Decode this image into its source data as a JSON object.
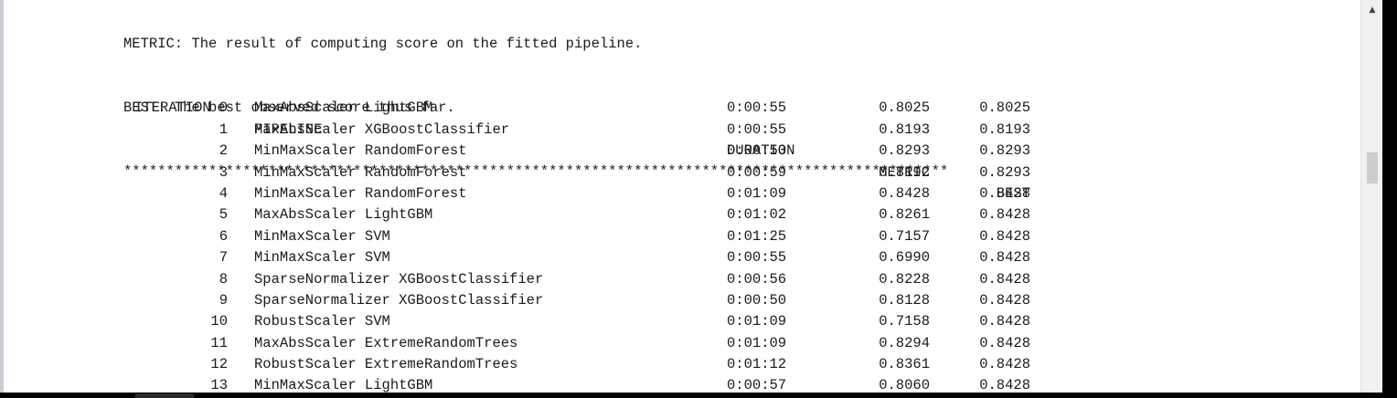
{
  "header": {
    "metric_line": "METRIC: The result of computing score on the fitted pipeline.",
    "best_line": "BEST: The best observed score thus far.",
    "separator": "*************************************************************************************************"
  },
  "table": {
    "columns": {
      "iteration": "ITERATION",
      "pipeline": "PIPELINE",
      "duration": "DURATION",
      "metric": "METRIC",
      "best": "BEST"
    },
    "rows": [
      {
        "iteration": "0",
        "pipeline": "MaxAbsScaler LightGBM",
        "duration": "0:00:55",
        "metric": "0.8025",
        "best": "0.8025"
      },
      {
        "iteration": "1",
        "pipeline": "MaxAbsScaler XGBoostClassifier",
        "duration": "0:00:55",
        "metric": "0.8193",
        "best": "0.8193"
      },
      {
        "iteration": "2",
        "pipeline": "MinMaxScaler RandomForest",
        "duration": "0:00:53",
        "metric": "0.8293",
        "best": "0.8293"
      },
      {
        "iteration": "3",
        "pipeline": "MinMaxScaler RandomForest",
        "duration": "0:00:59",
        "metric": "0.8192",
        "best": "0.8293"
      },
      {
        "iteration": "4",
        "pipeline": "MinMaxScaler RandomForest",
        "duration": "0:01:09",
        "metric": "0.8428",
        "best": "0.8428"
      },
      {
        "iteration": "5",
        "pipeline": "MaxAbsScaler LightGBM",
        "duration": "0:01:02",
        "metric": "0.8261",
        "best": "0.8428"
      },
      {
        "iteration": "6",
        "pipeline": "MinMaxScaler SVM",
        "duration": "0:01:25",
        "metric": "0.7157",
        "best": "0.8428"
      },
      {
        "iteration": "7",
        "pipeline": "MinMaxScaler SVM",
        "duration": "0:00:55",
        "metric": "0.6990",
        "best": "0.8428"
      },
      {
        "iteration": "8",
        "pipeline": "SparseNormalizer XGBoostClassifier",
        "duration": "0:00:56",
        "metric": "0.8228",
        "best": "0.8428"
      },
      {
        "iteration": "9",
        "pipeline": "SparseNormalizer XGBoostClassifier",
        "duration": "0:00:50",
        "metric": "0.8128",
        "best": "0.8428"
      },
      {
        "iteration": "10",
        "pipeline": "RobustScaler SVM",
        "duration": "0:01:09",
        "metric": "0.7158",
        "best": "0.8428"
      },
      {
        "iteration": "11",
        "pipeline": "MaxAbsScaler ExtremeRandomTrees",
        "duration": "0:01:09",
        "metric": "0.8294",
        "best": "0.8428"
      },
      {
        "iteration": "12",
        "pipeline": "RobustScaler ExtremeRandomTrees",
        "duration": "0:01:12",
        "metric": "0.8361",
        "best": "0.8428"
      },
      {
        "iteration": "13",
        "pipeline": "MinMaxScaler LightGBM",
        "duration": "0:00:57",
        "metric": "0.8060",
        "best": "0.8428"
      }
    ]
  },
  "scrollbar": {
    "up_arrow_icon": "scroll-up-arrow"
  }
}
